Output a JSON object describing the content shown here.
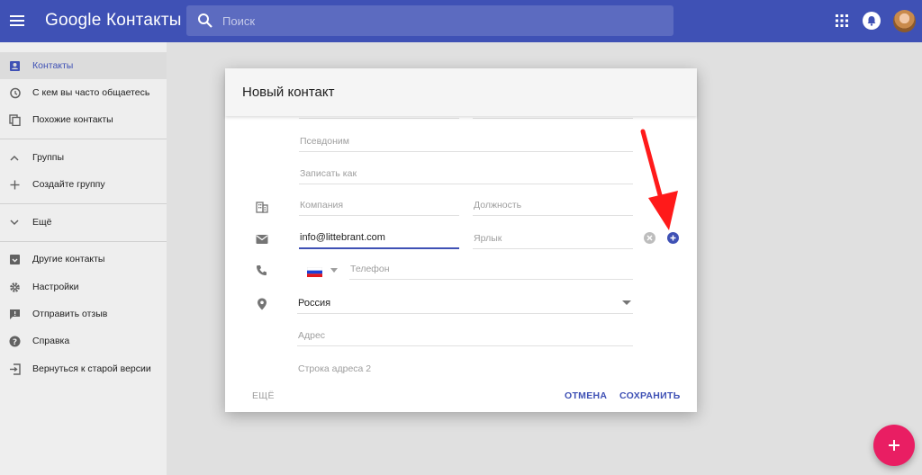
{
  "app": {
    "brand_google": "Google",
    "brand_name": "Контакты"
  },
  "search": {
    "placeholder": "Поиск"
  },
  "sidebar": {
    "items": [
      {
        "label": "Контакты",
        "icon": "contacts-icon"
      },
      {
        "label": "С кем вы часто общаетесь",
        "icon": "history-icon"
      },
      {
        "label": "Похожие контакты",
        "icon": "copy-icon"
      },
      {
        "label": "Группы",
        "icon": "chevron-up-icon"
      },
      {
        "label": "Создайте группу",
        "icon": "plus-icon"
      },
      {
        "label": "Ещё",
        "icon": "chevron-down-icon"
      },
      {
        "label": "Другие контакты",
        "icon": "archive-icon"
      },
      {
        "label": "Настройки",
        "icon": "gear-icon"
      },
      {
        "label": "Отправить отзыв",
        "icon": "feedback-icon"
      },
      {
        "label": "Справка",
        "icon": "help-icon"
      },
      {
        "label": "Вернуться к старой версии",
        "icon": "exit-icon"
      }
    ]
  },
  "dialog": {
    "title": "Новый контакт",
    "fields": {
      "nickname": "Псевдоним",
      "file_as": "Записать как",
      "company": "Компания",
      "job_title": "Должность",
      "email_value": "info@littebrant.com",
      "email_label": "Ярлык",
      "phone": "Телефон",
      "country_value": "Россия",
      "address": "Адрес",
      "address_line2": "Строка адреса 2"
    },
    "more_button": "ЕЩЁ",
    "cancel_button": "ОТМЕНА",
    "save_button": "СОХРАНИТЬ"
  },
  "colors": {
    "primary": "#3f51b5",
    "accent": "#e91e63",
    "annotation_arrow": "#ff1a1a"
  }
}
